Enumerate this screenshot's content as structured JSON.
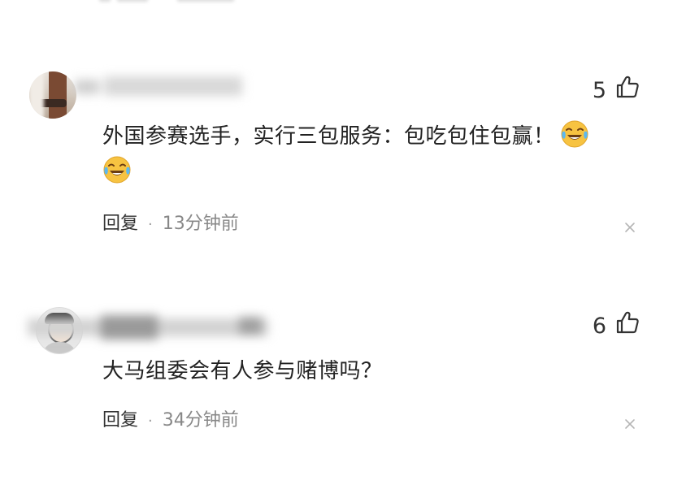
{
  "comments": [
    {
      "likes": "5",
      "text": "外国参赛选手，实行三包服务：包吃包住包赢！",
      "emojis": [
        "crying-laughing-emoji",
        "crying-laughing-emoji"
      ],
      "reply_label": "回复",
      "separator": "·",
      "time": "13分钟前"
    },
    {
      "likes": "6",
      "text": "大马组委会有人参与赌博吗？",
      "reply_label": "回复",
      "separator": "·",
      "time": "34分钟前"
    }
  ],
  "icons": {
    "like": "thumbs-up-icon",
    "close": "close-icon"
  },
  "colors": {
    "text": "#222222",
    "meta": "#888888",
    "emoji_face": "#f7c341"
  }
}
